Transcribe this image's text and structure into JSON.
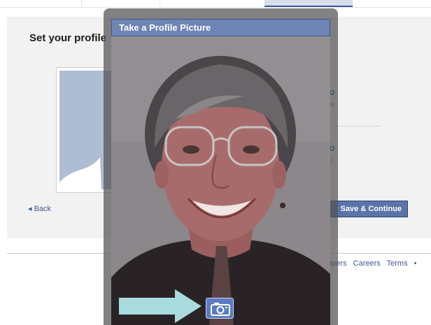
{
  "page": {
    "title": "Set your profile",
    "options": {
      "upload_title": "to",
      "upload_sub": "ter",
      "take_title": "to",
      "take_sub": "m"
    },
    "back_label": "◂ Back",
    "save_label": "Save & Continue",
    "footer_links": [
      "velopers",
      "Careers",
      "Terms",
      "•"
    ]
  },
  "dialog": {
    "title": "Take a Profile Picture",
    "capture_icon": "camera-icon",
    "pointer_icon": "arrow-right-icon"
  },
  "colors": {
    "fb_blue": "#3b5998",
    "title_bar": "#6d84b4",
    "capture_button": "#5b7cc2",
    "arrow": "#a9dbdc"
  }
}
